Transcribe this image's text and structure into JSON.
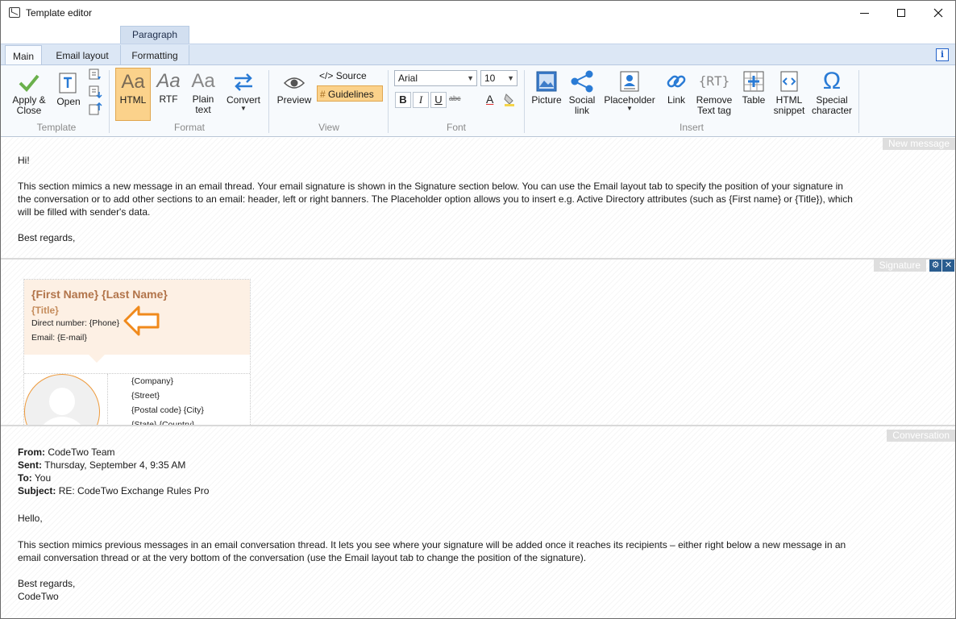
{
  "window": {
    "title": "Template editor"
  },
  "ribbon": {
    "context_group": "Paragraph",
    "tabs": [
      {
        "label": "Main"
      },
      {
        "label": "Email layout"
      },
      {
        "label": "Formatting"
      }
    ],
    "groups": {
      "template": {
        "label": "Template",
        "apply_close": [
          "Apply &",
          "Close"
        ],
        "open": "Open"
      },
      "format": {
        "label": "Format",
        "html": "HTML",
        "rtf": "RTF",
        "plain_text": [
          "Plain",
          "text"
        ],
        "convert": "Convert"
      },
      "view": {
        "label": "View",
        "preview": "Preview",
        "source": "Source",
        "guidelines": "Guidelines"
      },
      "font": {
        "label": "Font",
        "family": "Arial",
        "size": "10",
        "bold": "B",
        "italic": "I",
        "underline": "U",
        "strike": "abc",
        "color": "A"
      },
      "insert": {
        "label": "Insert",
        "picture": "Picture",
        "social_link": [
          "Social",
          "link"
        ],
        "placeholder": "Placeholder",
        "link": "Link",
        "remove_text_tag": [
          "Remove",
          "Text tag"
        ],
        "table": "Table",
        "html_snippet": [
          "HTML",
          "snippet"
        ],
        "special_character": [
          "Special",
          "character"
        ]
      }
    }
  },
  "new_message": {
    "tag": "New message",
    "greeting": "Hi!",
    "body_line1": "This section mimics a new message in an email thread. Your email signature is shown in the Signature section below. You can use the Email layout tab to specify the position of your signature in",
    "body_line2": "the conversation or to add other sections to an email: header, left or right banners. The Placeholder option allows you to insert e.g. Active Directory attributes (such as {First name} or {Title}), which",
    "body_line3": "will be filled with sender's data.",
    "closing": "Best regards,"
  },
  "signature": {
    "tag": "Signature",
    "name": "{First Name} {Last Name}",
    "title": "{Title}",
    "direct": "Direct number: {Phone}",
    "email": "Email: {E-mail}",
    "company": "{Company}",
    "street": "{Street}",
    "postal_city": "{Postal code} {City}",
    "state_country": "{State} {Country}"
  },
  "conversation": {
    "tag": "Conversation",
    "from_label": "From:",
    "from_value": "CodeTwo Team",
    "sent_label": "Sent:",
    "sent_value": "Thursday, September 4, 9:35 AM",
    "to_label": "To:",
    "to_value": "You",
    "subject_label": "Subject:",
    "subject_value": "RE: CodeTwo Exchange Rules Pro",
    "greeting": "Hello,",
    "body_line1": "This section mimics previous messages in an email conversation thread. It lets you see where your signature will be added once it reaches its recipients – either right below a new message in an",
    "body_line2": "email conversation thread or at the very bottom of the conversation (use the Email layout tab to change the position of the signature).",
    "closing": "Best regards,",
    "sender": "CodeTwo"
  },
  "colors": {
    "accent_blue": "#2563c9",
    "selected_btn": "#fbd28b",
    "signature_name": "#b2744a",
    "callout_arrow": "#f08a1c"
  }
}
